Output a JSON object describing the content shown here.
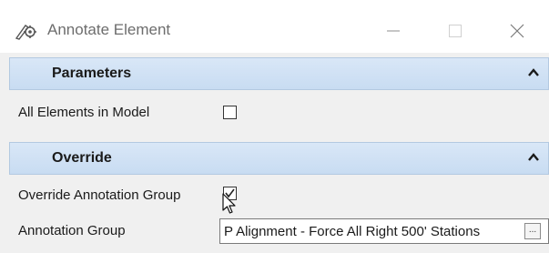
{
  "window": {
    "title": "Annotate Element",
    "icons": {
      "app": "gear-pencil-icon",
      "minimize": "minimize-icon",
      "maximize": "maximize-icon",
      "close": "close-icon"
    }
  },
  "sections": {
    "parameters": {
      "title": "Parameters",
      "collapse_icon": "chevron-up-icon",
      "all_elements_label": "All Elements in Model",
      "all_elements_checked": false
    },
    "override": {
      "title": "Override",
      "collapse_icon": "chevron-up-icon",
      "override_group_label": "Override Annotation Group",
      "override_group_checked": true,
      "annotation_group_label": "Annotation Group",
      "annotation_group_value": "P Alignment - Force All Right 500' Stations",
      "browse_label": "..."
    }
  }
}
